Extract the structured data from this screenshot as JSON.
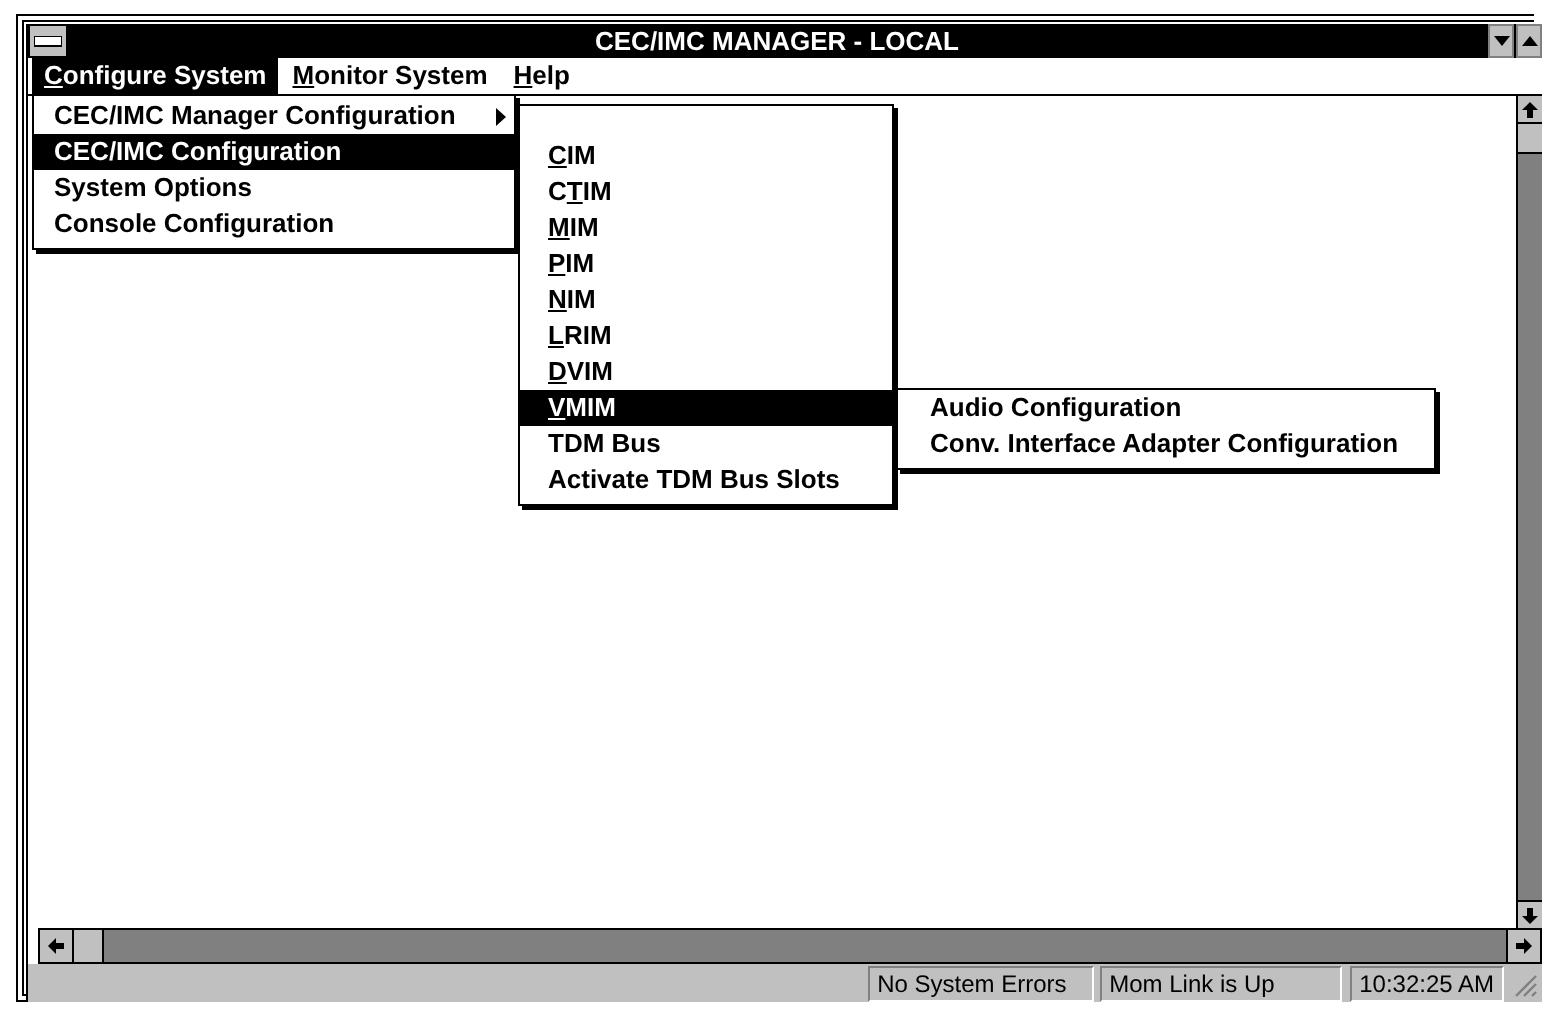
{
  "window": {
    "title": "CEC/IMC MANAGER - LOCAL"
  },
  "menu_bar": [
    {
      "key": "C",
      "post": "onfigure System",
      "selected": true
    },
    {
      "key": "M",
      "post": "onitor System",
      "selected": false
    },
    {
      "key": "H",
      "post": "elp",
      "selected": false
    }
  ],
  "dropdown": {
    "items": [
      {
        "label": "CEC/IMC Manager Configuration",
        "has_submenu": true,
        "selected": false
      },
      {
        "label": "CEC/IMC Configuration",
        "has_submenu": false,
        "selected": true
      },
      {
        "label": "System Options",
        "has_submenu": false,
        "selected": false
      },
      {
        "label": "Console Configuration",
        "has_submenu": false,
        "selected": false
      }
    ]
  },
  "submenu": {
    "items": [
      {
        "key": "C",
        "post": "IM",
        "selected": false
      },
      {
        "pre": "C",
        "key": "T",
        "post": "IM",
        "selected": false
      },
      {
        "key": "M",
        "post": "IM",
        "selected": false
      },
      {
        "key": "P",
        "post": "IM",
        "selected": false
      },
      {
        "key": "N",
        "post": "IM",
        "selected": false
      },
      {
        "key": "L",
        "post": "RIM",
        "selected": false
      },
      {
        "key": "D",
        "post": "VIM",
        "selected": false
      },
      {
        "key": "V",
        "post": "MIM",
        "selected": true
      },
      {
        "pre": "TDM Bus",
        "selected": false
      },
      {
        "pre": "Activate TDM Bus Slots",
        "selected": false
      }
    ]
  },
  "submenu_2": {
    "items": [
      {
        "label": "Audio Configuration",
        "selected": false
      },
      {
        "label": "Conv. Interface Adapter Configuration",
        "selected": false
      }
    ]
  },
  "status_bar": {
    "panels": [
      "No System Errors",
      "Mom Link is Up",
      "10:32:25 AM"
    ]
  }
}
